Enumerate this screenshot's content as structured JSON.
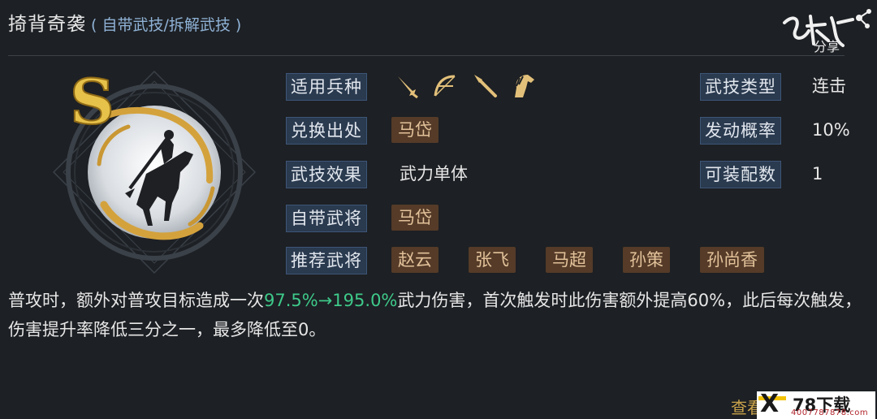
{
  "header": {
    "title": "掎背奇袭",
    "subtitle": "( 自带武技/拆解武技 )"
  },
  "watermark": {
    "text": "分享"
  },
  "skill": {
    "grade": "S",
    "rows": {
      "troop_label": "适用兵种",
      "troop_icons": [
        "sword-icon",
        "bow-icon",
        "spear-icon",
        "horse-icon"
      ],
      "exchange_label": "兑换出处",
      "exchange_value": "马岱",
      "effect_label": "武技效果",
      "effect_value": "武力单体",
      "owner_label": "自带武将",
      "owner_value": "马岱",
      "recommend_label": "推荐武将",
      "recommend_values": [
        "赵云",
        "张飞",
        "马超",
        "孙策",
        "孙尚香"
      ]
    },
    "side": {
      "type_label": "武技类型",
      "type_value": "连击",
      "rate_label": "发动概率",
      "rate_value": "10%",
      "equip_label": "可装配数",
      "equip_value": "1"
    }
  },
  "description": {
    "pre": "普攻时，额外对普攻目标造成一次",
    "highlight": "97.5%→195.0%",
    "post": "武力伤害，首次触发时此伤害额外提高60%，此后每次触发，伤害提升率降低三分之一，最多降低至0。"
  },
  "footer": {
    "view_link": "查看",
    "brand_name": "78下载",
    "brand_url": "4007787878.com"
  },
  "colors": {
    "background": "#1d2024",
    "label_bg": "#2a3a4f",
    "chip_bg": "#553b28",
    "chip_text": "#e2c29a",
    "highlight": "#3ec98a",
    "gold": "#c9a24a"
  }
}
